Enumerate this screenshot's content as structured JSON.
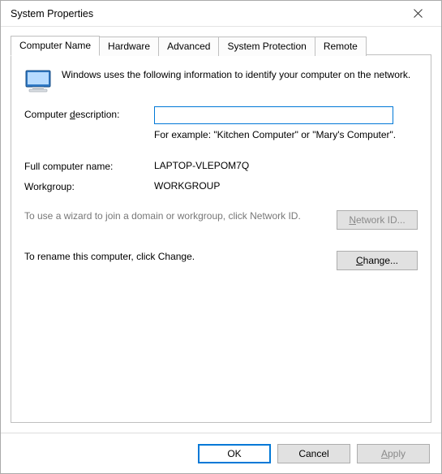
{
  "window": {
    "title": "System Properties"
  },
  "tabs": {
    "t0": "Computer Name",
    "t1": "Hardware",
    "t2": "Advanced",
    "t3": "System Protection",
    "t4": "Remote"
  },
  "panel": {
    "intro": "Windows uses the following information to identify your computer on the network.",
    "desc_label_pre": "Computer ",
    "desc_label_u": "d",
    "desc_label_post": "escription:",
    "desc_value": "",
    "desc_hint": "For example: \"Kitchen Computer\" or \"Mary's Computer\".",
    "fullname_label": "Full computer name:",
    "fullname_value": "LAPTOP-VLEPOM7Q",
    "workgroup_label": "Workgroup:",
    "workgroup_value": "WORKGROUP",
    "wizard_text": "To use a wizard to join a domain or workgroup, click Network ID.",
    "rename_text": "To rename this computer, click Change."
  },
  "buttons": {
    "network_id_u": "N",
    "network_id_rest": "etwork ID...",
    "change_u": "C",
    "change_rest": "hange...",
    "ok": "OK",
    "cancel": "Cancel",
    "apply_u": "A",
    "apply_rest": "pply"
  }
}
